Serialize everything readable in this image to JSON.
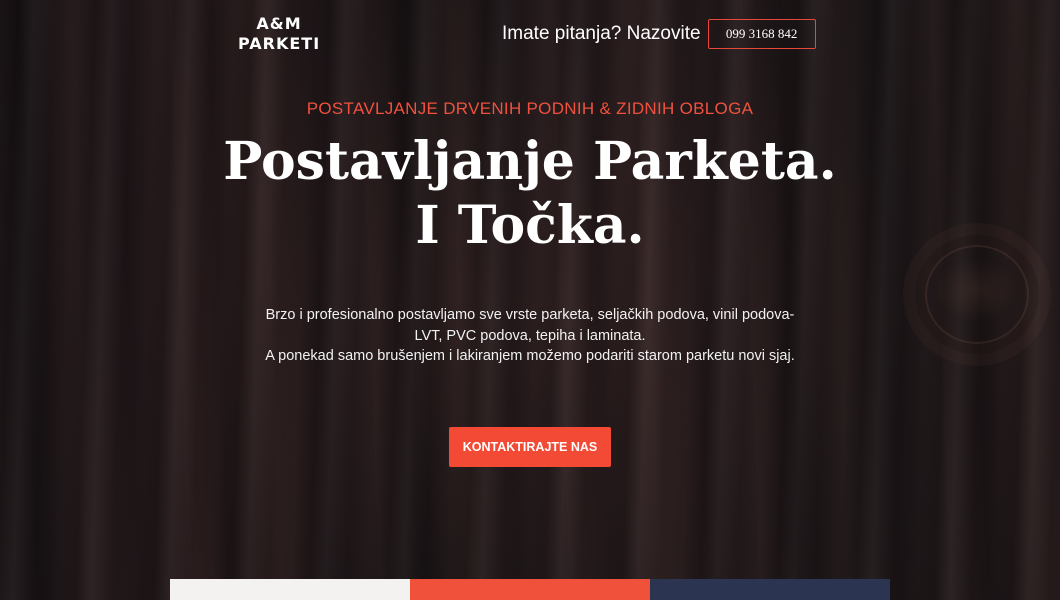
{
  "header": {
    "logo_line1": "A&M",
    "logo_line2": "PARKETI",
    "question": "Imate pitanja? Nazovite",
    "phone": "099 3168 842"
  },
  "hero": {
    "kicker": "POSTAVLJANJE DRVENIH PODNIH & ZIDNIH OBLOGA",
    "headline_line1": "Postavljanje Parketa.",
    "headline_line2": "I Točka.",
    "description_line1": "Brzo i profesionalno postavljamo sve vrste parketa, seljačkih podova, vinil podova-",
    "description_line2": "LVT, PVC podova, tepiha i laminata.",
    "description_line3": "A ponekad samo brušenjem i lakiranjem možemo podariti starom parketu novi sjaj.",
    "cta_label": "KONTAKTIRAJTE NAS"
  },
  "colors": {
    "accent": "#f24a35",
    "card_light": "#f4f2f1",
    "card_accent": "#f0513b",
    "card_dark": "#2b3451"
  }
}
